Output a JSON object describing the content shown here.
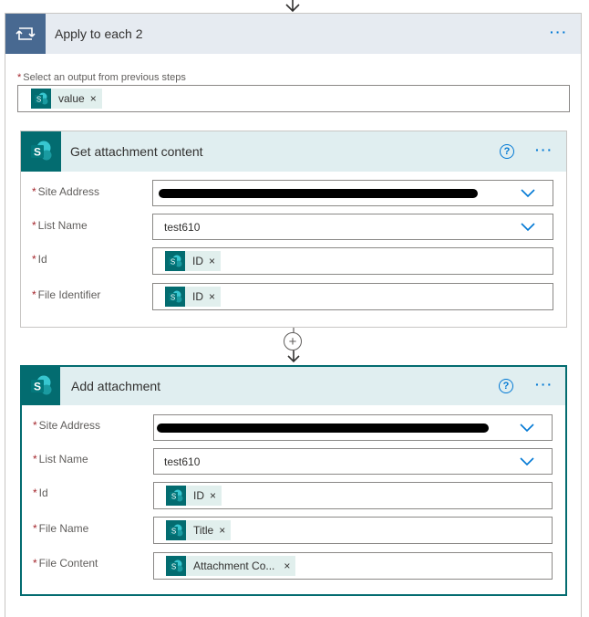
{
  "loop": {
    "title": "Apply to each 2",
    "select_label": "Select an output from previous steps",
    "token": "value",
    "more": "···"
  },
  "card1": {
    "title": "Get attachment content",
    "help": "?",
    "more": "···",
    "fields": {
      "site_address_label": "Site Address",
      "list_name_label": "List Name",
      "list_name_value": "test610",
      "id_label": "Id",
      "id_token": "ID",
      "file_identifier_label": "File Identifier",
      "file_identifier_token": "ID"
    }
  },
  "card2": {
    "title": "Add attachment",
    "help": "?",
    "more": "···",
    "fields": {
      "site_address_label": "Site Address",
      "list_name_label": "List Name",
      "list_name_value": "test610",
      "id_label": "Id",
      "id_token": "ID",
      "file_name_label": "File Name",
      "file_name_token": "Title",
      "file_content_label": "File Content",
      "file_content_token": "Attachment Co..."
    }
  },
  "common": {
    "required_mark": "*",
    "remove_glyph": "×",
    "add_glyph": "+"
  },
  "colors": {
    "loop_header": "#e6ebf1",
    "loop_icon": "#486991",
    "sharepoint": "#036c70",
    "card_header": "#e0eef0",
    "accent": "#0078d4"
  }
}
